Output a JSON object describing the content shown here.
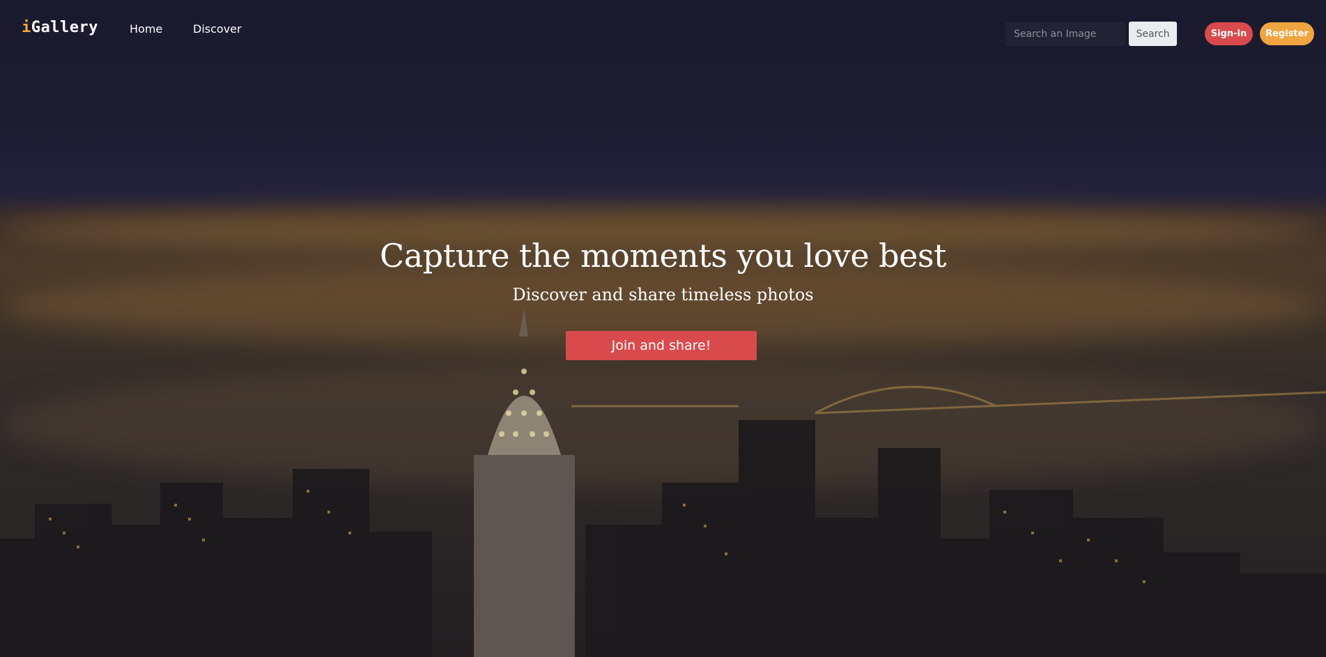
{
  "nav": {
    "brand_prefix": "i",
    "brand_rest": "Gallery",
    "links": [
      {
        "label": "Home"
      },
      {
        "label": "Discover"
      }
    ],
    "search_placeholder": "Search an Image",
    "search_button": "Search",
    "signin_button": "Sign-in",
    "register_button": "Register"
  },
  "hero": {
    "headline": "Capture the moments you love best",
    "subline": "Discover and share timeless photos",
    "cta": "Join and share!"
  },
  "colors": {
    "accent_red": "#d94a4d",
    "accent_orange": "#f0a541",
    "overlay_dark": "#1b1a2c"
  }
}
